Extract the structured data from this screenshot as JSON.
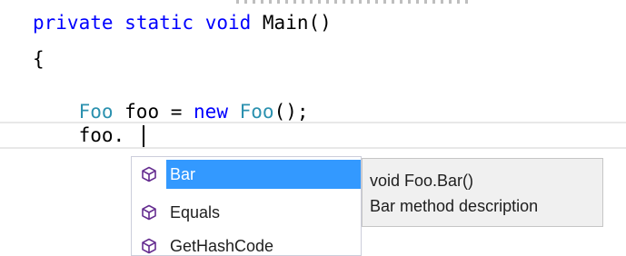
{
  "editor": {
    "lines": [
      {
        "tokens": [
          {
            "text": "private",
            "kind": "keyword"
          },
          {
            "text": " ",
            "kind": "plain"
          },
          {
            "text": "static",
            "kind": "keyword"
          },
          {
            "text": " ",
            "kind": "plain"
          },
          {
            "text": "void",
            "kind": "keyword"
          },
          {
            "text": " Main()",
            "kind": "plain"
          }
        ]
      },
      {
        "tokens": [
          {
            "text": "{",
            "kind": "plain"
          }
        ]
      },
      {
        "tokens": [
          {
            "text": "    ",
            "kind": "plain"
          },
          {
            "text": "Foo",
            "kind": "type"
          },
          {
            "text": " foo = ",
            "kind": "plain"
          },
          {
            "text": "new",
            "kind": "keyword"
          },
          {
            "text": " ",
            "kind": "plain"
          },
          {
            "text": "Foo",
            "kind": "type"
          },
          {
            "text": "();",
            "kind": "plain"
          }
        ]
      },
      {
        "tokens": [
          {
            "text": "    foo.",
            "kind": "plain"
          }
        ]
      }
    ],
    "colors": {
      "keyword": "#0000ff",
      "type": "#2b91af",
      "plain": "#000000"
    }
  },
  "completion": {
    "items": [
      {
        "label": "Bar",
        "icon": "method-icon",
        "selected": true
      },
      {
        "label": "Equals",
        "icon": "method-icon",
        "selected": false
      },
      {
        "label": "GetHashCode",
        "icon": "method-icon",
        "selected": false
      }
    ],
    "selection_color": "#3399ff",
    "icon_color": "#652d90"
  },
  "tooltip": {
    "signature": "void Foo.Bar()",
    "description": "Bar method description"
  }
}
